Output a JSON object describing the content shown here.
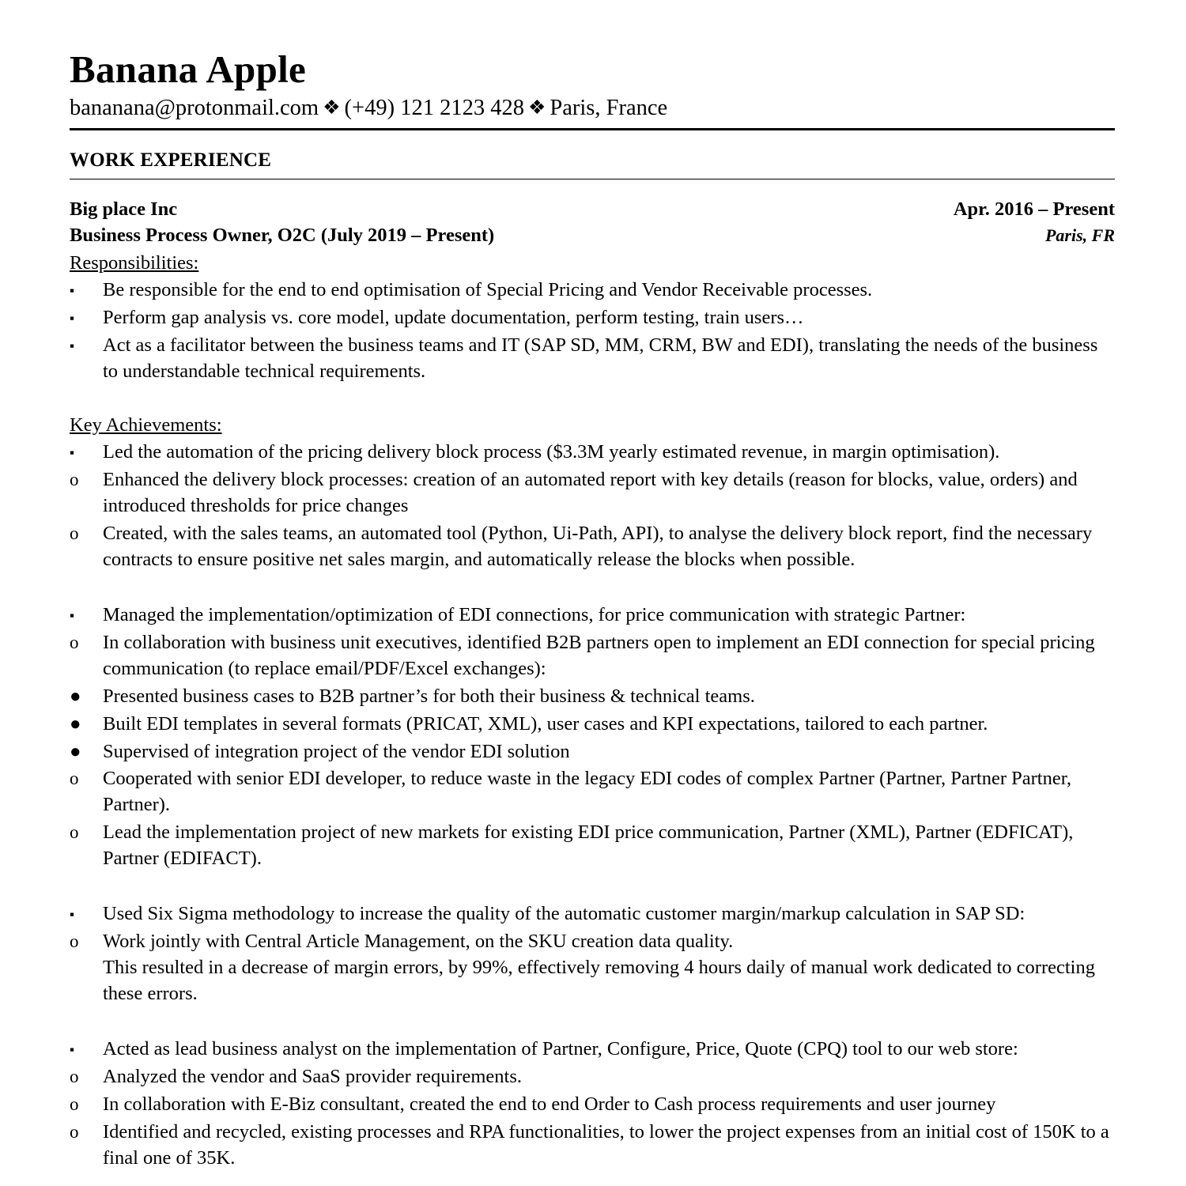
{
  "header": {
    "name": "Banana Apple",
    "contact": {
      "email": "bananana@protonmail.com",
      "separator_1": "❖",
      "phone": "(+49) 121 2123 428",
      "separator_2": "❖",
      "location": "Paris, France"
    }
  },
  "sections": [
    {
      "title": "WORK EXPERIENCE",
      "job": {
        "company": "Big place Inc",
        "dates": "Apr. 2016 – Present",
        "role": "Business Process Owner, O2C (July 2019 – Present)",
        "location": "Paris, FR",
        "responsibilities_label": "Responsibilities:",
        "responsibilities": [
          "Be responsible for the end to end optimisation of Special Pricing and Vendor Receivable processes.",
          "Perform gap analysis vs. core model, update documentation, perform testing, train users…",
          "Act as a facilitator between the business teams and IT (SAP SD, MM, CRM, BW and EDI), translating the needs of the business to understandable technical requirements."
        ],
        "achievements_label": "Key Achievements:",
        "achievements": [
          {
            "text": "Led the automation of the pricing delivery block process ($3.3M yearly estimated revenue, in margin optimisation).",
            "sub": [
              {
                "text": "Enhanced the delivery block processes: creation of an automated report with key details (reason for blocks, value, orders) and introduced thresholds for price changes"
              },
              {
                "text": "Created, with the sales teams, an automated tool (Python, Ui-Path, API), to analyse the delivery block report, find the necessary contracts to ensure positive net sales margin, and automatically release the blocks when possible."
              }
            ]
          },
          {
            "text": "Managed the implementation/optimization of EDI connections, for price communication with strategic Partner:",
            "sub": [
              {
                "text": "In collaboration with business unit executives, identified B2B partners open to implement an EDI connection for special pricing communication (to replace email/PDF/Excel exchanges):",
                "sub": [
                  {
                    "text": "Presented business cases to B2B partner’s for both their business & technical teams."
                  },
                  {
                    "text": "Built EDI templates in several formats (PRICAT, XML), user cases and KPI expectations, tailored to each partner."
                  },
                  {
                    "text": "Supervised of integration project of the vendor EDI solution"
                  }
                ]
              },
              {
                "text": "Cooperated with senior EDI developer, to reduce waste in the legacy EDI codes of complex Partner (Partner, Partner Partner, Partner)."
              },
              {
                "text": "Lead the implementation project of new markets for existing EDI price communication, Partner (XML), Partner (EDFICAT), Partner (EDIFACT)."
              }
            ]
          },
          {
            "text": "Used Six Sigma methodology to increase the quality of the automatic customer margin/markup calculation in SAP SD:",
            "sub": [
              {
                "text": "Work jointly with Central Article Management, on the SKU creation data quality.",
                "continuation": "This resulted in a decrease of margin errors, by 99%, effectively removing 4 hours daily of manual work dedicated to correcting these errors."
              }
            ]
          },
          {
            "text": "Acted as lead business analyst on the implementation of Partner, Configure, Price, Quote (CPQ) tool to our web store:",
            "sub": [
              {
                "text": "Analyzed the vendor and SaaS provider requirements."
              },
              {
                "text": "In collaboration with E-Biz consultant, created the end to end Order to Cash process requirements and user journey"
              },
              {
                "text": "Identified and recycled, existing processes and RPA functionalities, to lower the project expenses from an initial cost of 150K to a final one of 35K."
              }
            ]
          }
        ]
      }
    }
  ],
  "markers": {
    "level1": "▪",
    "level2": "o",
    "level3": "●"
  }
}
